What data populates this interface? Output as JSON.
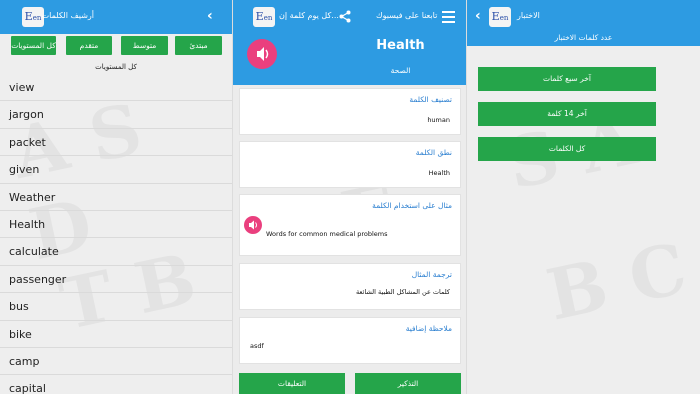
{
  "colors": {
    "primary": "#2d9be2",
    "button_green": "#25a54a",
    "speaker_pink": "#ea3f7e",
    "link_blue": "#2b7fd0"
  },
  "icons": {
    "logo": "en-logo-icon",
    "back": "chevron-left-icon",
    "share": "share-icon",
    "menu": "hamburger-menu-icon",
    "speaker": "speaker-icon"
  },
  "logo": {
    "main": "E",
    "sub": "en"
  },
  "archive": {
    "title": "أرشيف الكلمات",
    "levels": [
      "كل المستويات",
      "متقدم",
      "متوسط",
      "مبتدئ"
    ],
    "selected_level": "كل المستويات",
    "words": [
      "view",
      "jargon",
      "packet",
      "given",
      "Weather",
      "Health",
      "calculate",
      "passenger",
      "bus",
      "bike",
      "camp",
      "capital"
    ]
  },
  "word_detail": {
    "daily_title": "كل يوم كلمة إن...",
    "facebook_label": "تابعنا على فيسبوك",
    "word": "Health",
    "translation": "الصحة",
    "cards": [
      {
        "heading": "تصنيف الكلمة",
        "value": "human"
      },
      {
        "heading": "نطق الكلمة",
        "value": "Health"
      },
      {
        "heading": "مثال على استخدام الكلمة",
        "value": "Words for common medical problems"
      },
      {
        "heading": "ترجمة المثال",
        "value": "كلمات عن المشاكل الطبية الشائعة"
      },
      {
        "heading": "ملاحظة إضافية",
        "value": "asdf"
      }
    ],
    "buttons": {
      "remind": "التذكير",
      "comments": "التعليقات"
    }
  },
  "quiz": {
    "title": "الاختبار",
    "subtitle": "عدد كلمات الاختبار",
    "options": [
      "آخر سبع كلمات",
      "آخر 14 كلمة",
      "كل الكلمات"
    ]
  }
}
